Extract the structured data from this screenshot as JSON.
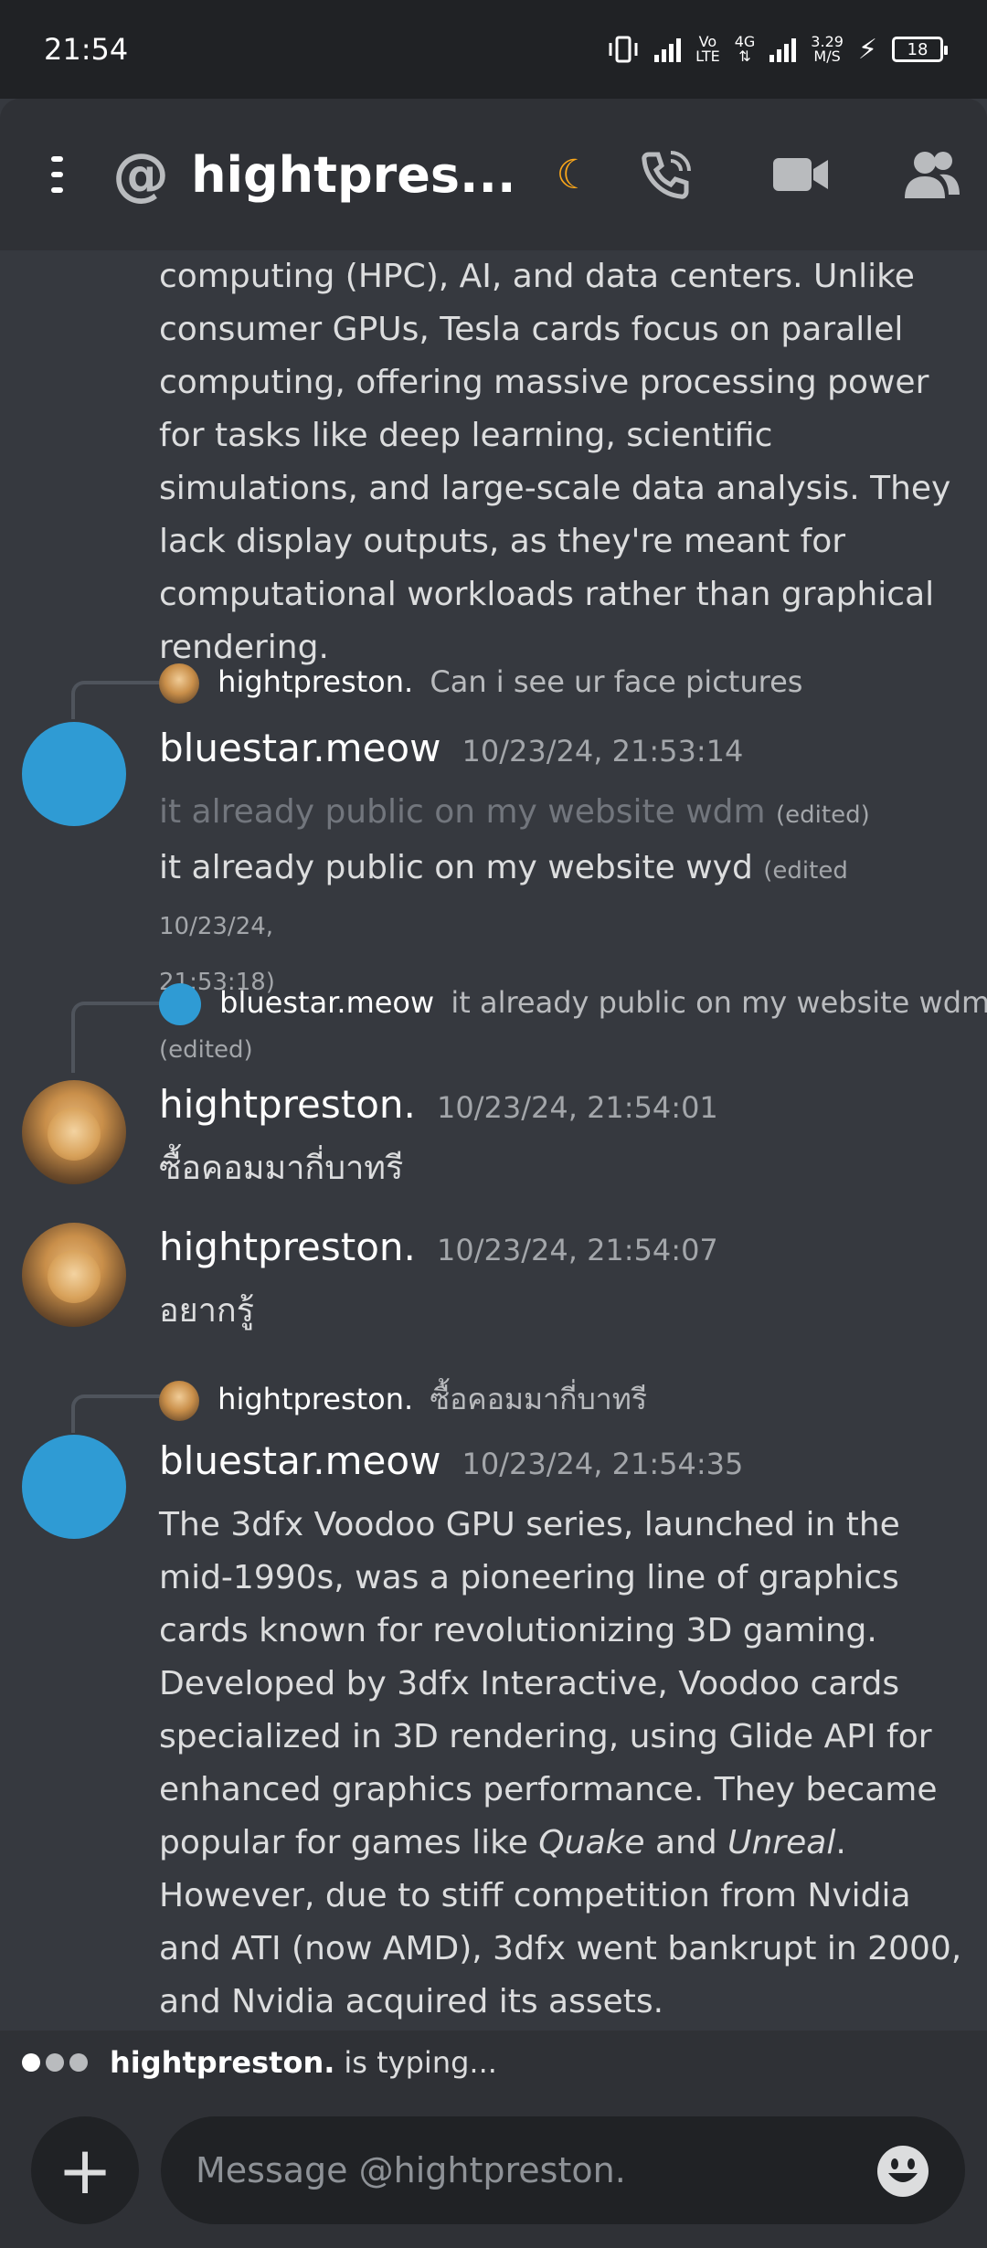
{
  "status_bar": {
    "time": "21:54",
    "network_lte_top": "Vo",
    "network_lte_bottom": "LTE",
    "network_4g": "4G",
    "speed_top": "3.29",
    "speed_bottom": "M/S",
    "battery": "18"
  },
  "header": {
    "title": "hightpres...",
    "icons": [
      "menu-icon",
      "at-icon",
      "moon-icon",
      "call-icon",
      "video-icon",
      "members-icon"
    ]
  },
  "messages": {
    "continued_text": "computing (HPC), AI, and data centers. Unlike consumer GPUs, Tesla cards focus on parallel computing, offering massive processing power for tasks like deep learning, scientific simulations, and large-scale data analysis. They lack display outputs, as they're meant for computational workloads rather than graphical rendering.",
    "m1": {
      "reply_name": "hightpreston.",
      "reply_text": "Can i see ur face pictures",
      "author": "bluestar.meow",
      "time": "10/23/24, 21:53:14",
      "line1": "it already public on my website wdm",
      "line1_edited": "(edited)",
      "line2": "it already public on my website wyd",
      "line2_edited_a": "(edited 10/23/24,",
      "line2_edited_b": "21:53:18)"
    },
    "m2": {
      "reply_name": "bluestar.meow",
      "reply_text": "it already public on my website wdm",
      "reply_edited": "(edited)",
      "author": "hightpreston.",
      "time": "10/23/24, 21:54:01",
      "text": "ซื้อคอมมากี่บาทรี"
    },
    "m3": {
      "author": "hightpreston.",
      "time": "10/23/24, 21:54:07",
      "text": "อยากรู้"
    },
    "m4": {
      "reply_name": "hightpreston.",
      "reply_text": "ซื้อคอมมากี่บาทรี",
      "author": "bluestar.meow",
      "time": "10/23/24, 21:54:35",
      "text_part1": "The 3dfx Voodoo GPU series, launched in the mid-1990s, was a pioneering line of graphics cards known for revolutionizing 3D gaming. Developed by 3dfx Interactive, Voodoo cards specialized in 3D rendering, using Glide API for enhanced graphics performance. They became popular for games like ",
      "italic1": "Quake",
      "text_and": " and ",
      "italic2": "Unreal",
      "text_part2": ". However, due to stiff competition from Nvidia and ATI (now AMD), 3dfx went bankrupt in 2000, and Nvidia acquired its assets."
    }
  },
  "typing": {
    "name": "hightpreston.",
    "suffix": "is typing..."
  },
  "composer": {
    "plus": "+",
    "placeholder": "Message @hightpreston."
  }
}
